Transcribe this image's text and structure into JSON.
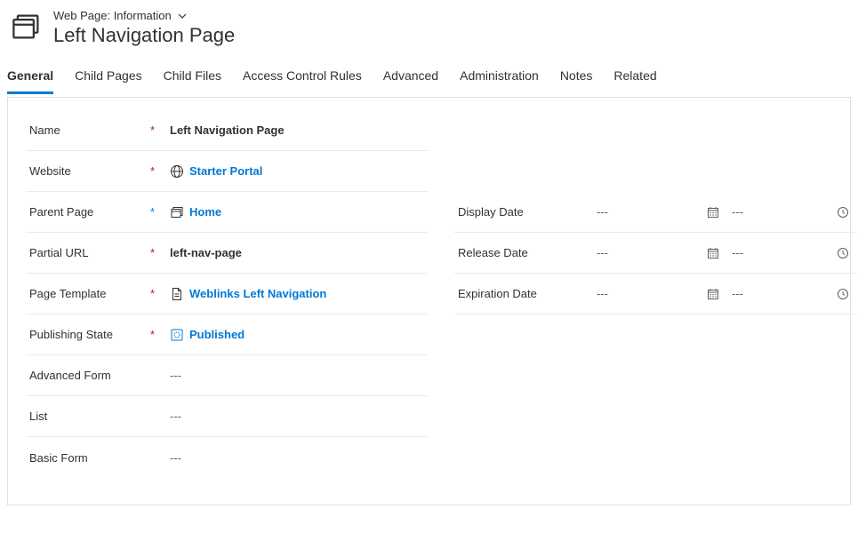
{
  "header": {
    "breadcrumb": "Web Page: Information",
    "title": "Left Navigation Page"
  },
  "tabs": [
    "General",
    "Child Pages",
    "Child Files",
    "Access Control Rules",
    "Advanced",
    "Administration",
    "Notes",
    "Related"
  ],
  "activeTab": 0,
  "fields": {
    "name": {
      "label": "Name",
      "value": "Left Navigation Page"
    },
    "website": {
      "label": "Website",
      "value": "Starter Portal"
    },
    "parentPage": {
      "label": "Parent Page",
      "value": "Home"
    },
    "partialUrl": {
      "label": "Partial URL",
      "value": "left-nav-page"
    },
    "pageTemplate": {
      "label": "Page Template",
      "value": "Weblinks Left Navigation"
    },
    "publishingState": {
      "label": "Publishing State",
      "value": "Published"
    },
    "advancedForm": {
      "label": "Advanced Form",
      "value": "---"
    },
    "list": {
      "label": "List",
      "value": "---"
    },
    "basicForm": {
      "label": "Basic Form",
      "value": "---"
    }
  },
  "dates": {
    "displayDate": {
      "label": "Display Date",
      "date": "---",
      "time": "---"
    },
    "releaseDate": {
      "label": "Release Date",
      "date": "---",
      "time": "---"
    },
    "expirationDate": {
      "label": "Expiration Date",
      "date": "---",
      "time": "---"
    }
  }
}
